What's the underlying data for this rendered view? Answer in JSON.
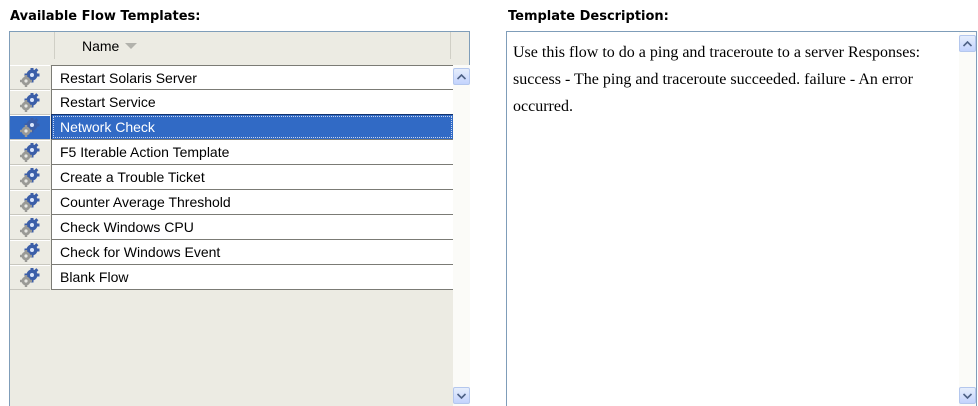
{
  "left_section": {
    "title": "Available Flow Templates:",
    "column_header": "Name",
    "items": [
      {
        "label": "Restart Solaris Server",
        "selected": false
      },
      {
        "label": "Restart Service",
        "selected": false
      },
      {
        "label": "Network Check",
        "selected": true
      },
      {
        "label": "F5 Iterable Action Template",
        "selected": false
      },
      {
        "label": "Create a Trouble Ticket",
        "selected": false
      },
      {
        "label": "Counter Average Threshold",
        "selected": false
      },
      {
        "label": "Check Windows CPU",
        "selected": false
      },
      {
        "label": "Check for Windows Event",
        "selected": false
      },
      {
        "label": "Blank Flow",
        "selected": false
      }
    ]
  },
  "right_section": {
    "title": "Template Description:",
    "description": "Use this flow to do a ping and traceroute to a server Responses: success - The ping and traceroute succeeded. failure - An error occurred."
  },
  "icons": {
    "item_icon": "gear-icon",
    "scroll_up": "chevron-up-icon",
    "scroll_down": "chevron-down-icon",
    "sort_indicator": "sort-down-icon"
  },
  "colors": {
    "selection": "#316ac5",
    "panel_background": "#ecebe3",
    "border": "#7f9db9"
  }
}
